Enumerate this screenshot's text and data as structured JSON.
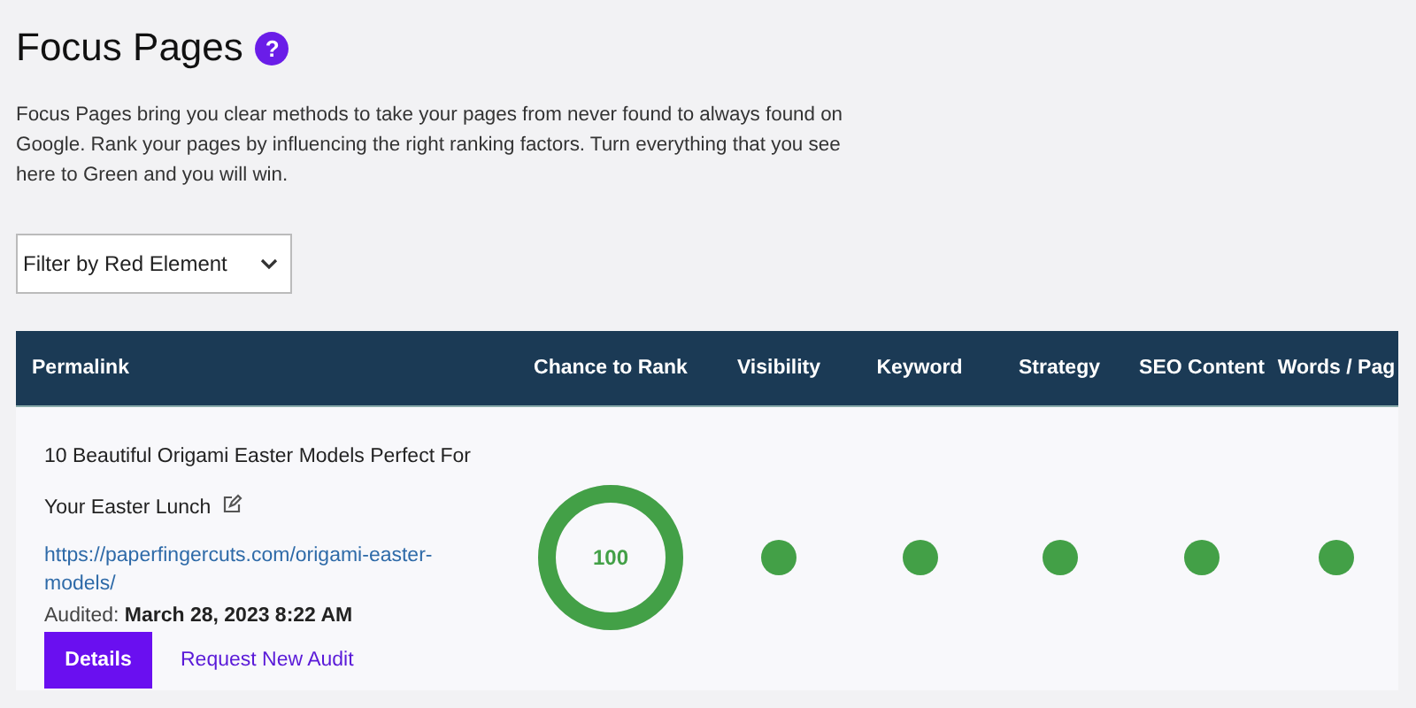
{
  "title": "Focus Pages",
  "help_icon": "?",
  "description": "Focus Pages bring you clear methods to take your pages from never found to always found on Google. Rank your pages by influencing the right ranking factors. Turn everything that you see here to Green and you will win.",
  "filter": {
    "value": "Filter by Red Element"
  },
  "table": {
    "columns": [
      "Permalink",
      "Chance to Rank",
      "Visibility",
      "Keyword",
      "Strategy",
      "SEO Content",
      "Words / Pag"
    ],
    "rows": [
      {
        "title": "10 Beautiful Origami Easter Models Perfect For Your Easter Lunch",
        "url": "https://paperfingercuts.com/origami-easter-models/",
        "audited_label": "Audited:",
        "audited": "March 28, 2023 8:22 AM",
        "score": "100",
        "level": 1,
        "factors": [
          {
            "color": "#43a047"
          },
          {
            "color": "#43a047"
          },
          {
            "color": "#43a047"
          },
          {
            "color": "#43a047"
          },
          {
            "color": "#43a047"
          }
        ],
        "buttons": [
          "Details",
          "Request New Audit"
        ]
      }
    ]
  }
}
